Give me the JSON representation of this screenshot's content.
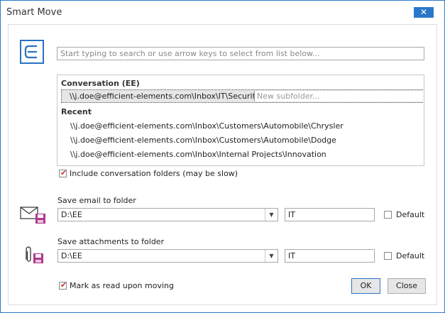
{
  "window": {
    "title": "Smart Move",
    "close_glyph": "✕"
  },
  "search": {
    "placeholder": "Start typing to search or use arrow keys to select from list below..."
  },
  "conversation": {
    "header": "Conversation (EE)",
    "selected_path": "\\\\j.doe@efficient-elements.com\\Inbox\\IT\\Security\\",
    "subfolder_placeholder": "New subfolder..."
  },
  "recent": {
    "header": "Recent",
    "items": [
      "\\\\j.doe@efficient-elements.com\\Inbox\\Customers\\Automobile\\Chrysler",
      "\\\\j.doe@efficient-elements.com\\Inbox\\Customers\\Automobile\\Dodge",
      "\\\\j.doe@efficient-elements.com\\Inbox\\Internal Projects\\Innovation"
    ]
  },
  "include_conversation": {
    "label": "Include conversation folders (may be slow)",
    "checked": true
  },
  "save_email": {
    "label": "Save email to folder",
    "folder": "D:\\EE",
    "subfolder": "IT",
    "default_label": "Default",
    "default_checked": false
  },
  "save_attachments": {
    "label": "Save attachments to folder",
    "folder": "D:\\EE",
    "subfolder": "IT",
    "default_label": "Default",
    "default_checked": false
  },
  "mark_read": {
    "label": "Mark as read upon moving",
    "checked": true
  },
  "buttons": {
    "ok": "OK",
    "close": "Close"
  },
  "colors": {
    "accent": "#2a78c8",
    "check": "#c0392b",
    "floppy": "#b0388f"
  },
  "icons": {
    "logo": "efficient-elements-logo",
    "email": "envelope-save-icon",
    "attachment": "paperclip-save-icon",
    "dropdown": "chevron-down-icon",
    "check": "checkmark-icon"
  }
}
